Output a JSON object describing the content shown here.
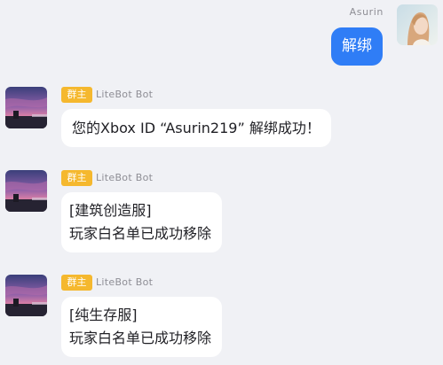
{
  "self": {
    "name": "Asurin",
    "message": "解绑"
  },
  "messages": [
    {
      "badge": "群主",
      "sender": "LiteBot Bot",
      "lines": [
        "您的Xbox ID “Asurin219” 解绑成功！"
      ]
    },
    {
      "badge": "群主",
      "sender": "LiteBot Bot",
      "lines": [
        "[建筑创造服]",
        "玩家白名单已成功移除"
      ]
    },
    {
      "badge": "群主",
      "sender": "LiteBot Bot",
      "lines": [
        "[纯生存服]",
        "玩家白名单已成功移除"
      ]
    }
  ],
  "colors": {
    "background": "#f0f1f5",
    "self_bubble": "#2f7df6",
    "bot_bubble": "#ffffff",
    "badge": "#f5b82e",
    "name_text": "#8e8e95"
  },
  "icons": {
    "self_avatar": "user-avatar-icon",
    "bot_avatar": "bot-avatar-icon"
  }
}
